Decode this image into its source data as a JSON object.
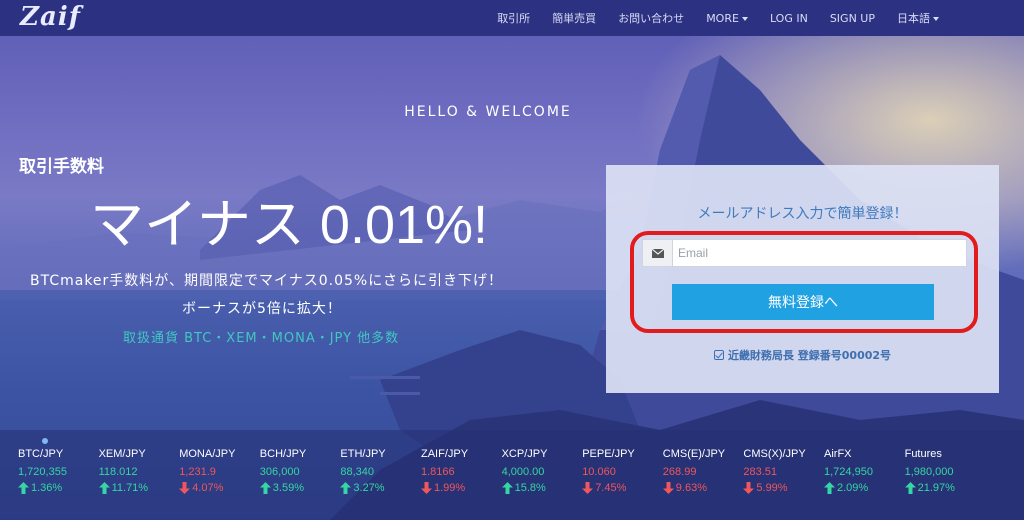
{
  "nav": {
    "logo": "Zaif",
    "links": [
      "取引所",
      "簡単売買",
      "お問い合わせ",
      "MORE",
      "LOG IN",
      "SIGN UP",
      "日本語"
    ]
  },
  "hero": {
    "welcome": "HELLO & WELCOME",
    "fee_label": "取引手数料",
    "fee_value": "マイナス 0.01%!",
    "promo_line1": "BTCmaker手数料が、期間限定でマイナス0.05%にさらに引き下げ！",
    "promo_line2": "ボーナスが5倍に拡大！",
    "currencies": "取扱通貨 BTC・XEM・MONA・JPY 他多数"
  },
  "register": {
    "title": "メールアドレス入力で簡単登録！",
    "email_placeholder": "Email",
    "email_value": "",
    "button_label": "無料登録へ",
    "license": "近畿財務局長 登録番号00002号"
  },
  "colors": {
    "up": "#35d6a3",
    "down": "#f0565b",
    "button": "#20a2e2",
    "highlight": "#e21c1c",
    "navbar": "#2c3281"
  },
  "ticker": [
    {
      "pair": "BTC/JPY",
      "price": "1,720,355",
      "change": "1.36%",
      "direction": "up"
    },
    {
      "pair": "XEM/JPY",
      "price": "118.012",
      "change": "11.71%",
      "direction": "up"
    },
    {
      "pair": "MONA/JPY",
      "price": "1,231.9",
      "change": "4.07%",
      "direction": "down"
    },
    {
      "pair": "BCH/JPY",
      "price": "306,000",
      "change": "3.59%",
      "direction": "up"
    },
    {
      "pair": "ETH/JPY",
      "price": "88,340",
      "change": "3.27%",
      "direction": "up"
    },
    {
      "pair": "ZAIF/JPY",
      "price": "1.8166",
      "change": "1.99%",
      "direction": "down"
    },
    {
      "pair": "XCP/JPY",
      "price": "4,000.00",
      "change": "15.8%",
      "direction": "up"
    },
    {
      "pair": "PEPE/JPY",
      "price": "10.060",
      "change": "7.45%",
      "direction": "down"
    },
    {
      "pair": "CMS(E)/JPY",
      "price": "268.99",
      "change": "9.63%",
      "direction": "down"
    },
    {
      "pair": "CMS(X)/JPY",
      "price": "283.51",
      "change": "5.99%",
      "direction": "down"
    },
    {
      "pair": "AirFX",
      "price": "1,724,950",
      "change": "2.09%",
      "direction": "up"
    },
    {
      "pair": "Futures",
      "price": "1,980,000",
      "change": "21.97%",
      "direction": "up"
    }
  ]
}
